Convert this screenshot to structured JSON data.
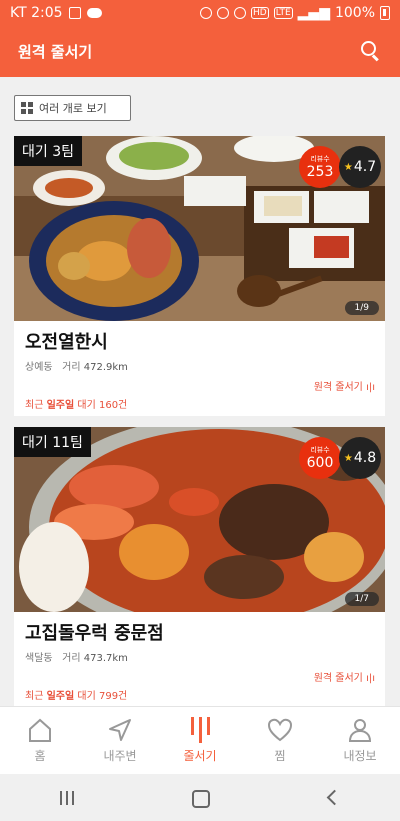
{
  "status_bar": {
    "carrier_time": "KT 2:05",
    "network": "LTE",
    "battery": "100%"
  },
  "app_bar": {
    "title": "원격 줄서기"
  },
  "view_toggle": {
    "label": "여러 개로 보기"
  },
  "restaurants": [
    {
      "wait": "대기 3팀",
      "review_label": "리뷰수",
      "review_count": "253",
      "rating": "4.7",
      "photo_counter": "1/9",
      "name": "오전열한시",
      "area": "상예동",
      "distance_label": "거리",
      "distance": "472.9km",
      "remote_link": "원격 줄서기",
      "recent_prefix": "최근",
      "recent_week": "일주일",
      "recent_suffix": "대기 160건"
    },
    {
      "wait": "대기 11팀",
      "review_label": "리뷰수",
      "review_count": "600",
      "rating": "4.8",
      "photo_counter": "1/7",
      "name": "고집돌우럭 중문점",
      "area": "색달동",
      "distance_label": "거리",
      "distance": "473.7km",
      "remote_link": "원격 줄서기",
      "recent_prefix": "최근",
      "recent_week": "일주일",
      "recent_suffix": "대기 799건"
    }
  ],
  "bottom_nav": [
    {
      "label": "홈",
      "icon": "home-icon"
    },
    {
      "label": "내주변",
      "icon": "navigation-arrow-icon"
    },
    {
      "label": "줄서기",
      "icon": "queue-icon"
    },
    {
      "label": "찜",
      "icon": "heart-icon"
    },
    {
      "label": "내정보",
      "icon": "person-icon"
    }
  ],
  "colors": {
    "accent": "#f4603c",
    "review_badge": "#e8300e",
    "rating_star": "#f7c21f"
  }
}
